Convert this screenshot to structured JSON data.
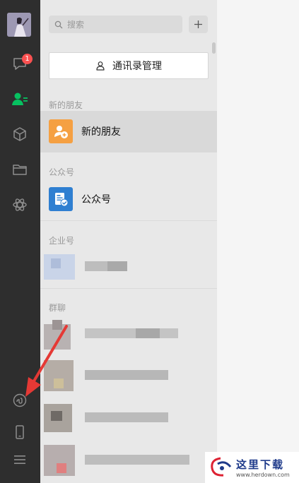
{
  "sidebar": {
    "chat_badge": "1",
    "icons": [
      "chat-icon",
      "contacts-icon",
      "box-icon",
      "folder-icon",
      "moments-icon",
      "mini-program-icon",
      "phone-icon",
      "menu-icon"
    ],
    "active": "contacts-icon"
  },
  "contacts": {
    "search_placeholder": "搜索",
    "add_label": "+",
    "manage_button": "通讯录管理",
    "sections": [
      {
        "label": "新的朋友",
        "item": "新的朋友"
      },
      {
        "label": "公众号",
        "item": "公众号"
      },
      {
        "label": "企业号"
      }
    ],
    "blurred_section_label": "群聊"
  },
  "colors": {
    "sidebar_bg": "#2e2e2e",
    "accent_green": "#07c160",
    "badge_red": "#fa5151",
    "new_friend_orange": "#f5a042",
    "official_blue": "#2f7fd1",
    "arrow_red": "#e53935"
  },
  "watermark": {
    "cn": "这里下载",
    "url": "www.herdown.com"
  }
}
